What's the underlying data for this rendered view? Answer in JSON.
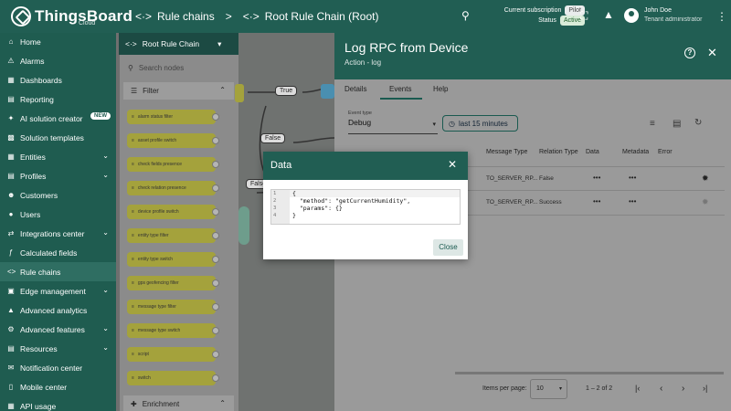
{
  "app": {
    "name": "ThingsBoard",
    "edition": "Cloud"
  },
  "breadcrumbs": {
    "item1": "Rule chains",
    "separator": ">",
    "item2": "Root Rule Chain (Root)"
  },
  "subscription": {
    "label": "Current subscription",
    "plan": "Pilot",
    "status_label": "Status",
    "status": "Active"
  },
  "user": {
    "name": "John Doe",
    "role": "Tenant administrator"
  },
  "sidebar": {
    "items": [
      {
        "label": "Home",
        "icon": "home-icon"
      },
      {
        "label": "Alarms",
        "icon": "bell-icon"
      },
      {
        "label": "Dashboards",
        "icon": "dashboard-icon"
      },
      {
        "label": "Reporting",
        "icon": "report-icon"
      },
      {
        "label": "AI solution creator",
        "icon": "sparkle-icon",
        "badge": "NEW"
      },
      {
        "label": "Solution templates",
        "icon": "template-icon"
      },
      {
        "label": "Entities",
        "icon": "entities-icon"
      },
      {
        "label": "Profiles",
        "icon": "profiles-icon"
      },
      {
        "label": "Customers",
        "icon": "customers-icon"
      },
      {
        "label": "Users",
        "icon": "users-icon"
      },
      {
        "label": "Integrations center",
        "icon": "integrations-icon"
      },
      {
        "label": "Calculated fields",
        "icon": "function-icon"
      },
      {
        "label": "Rule chains",
        "icon": "rule-chain-icon"
      },
      {
        "label": "Edge management",
        "icon": "edge-icon"
      },
      {
        "label": "Advanced analytics",
        "icon": "analytics-icon"
      },
      {
        "label": "Advanced features",
        "icon": "features-icon"
      },
      {
        "label": "Resources",
        "icon": "folder-icon"
      },
      {
        "label": "Notification center",
        "icon": "notification-icon"
      },
      {
        "label": "Mobile center",
        "icon": "mobile-icon"
      },
      {
        "label": "API usage",
        "icon": "api-icon"
      }
    ]
  },
  "library": {
    "header": "Root Rule Chain",
    "search_placeholder": "Search nodes",
    "filter_section": "Filter",
    "enrichment_section": "Enrichment",
    "nodes": [
      "alarm status filter",
      "asset profile switch",
      "check fields presence",
      "check relation presence",
      "device profile switch",
      "entity type filter",
      "entity type switch",
      "gps geofencing filter",
      "message type filter",
      "message type switch",
      "script",
      "switch"
    ]
  },
  "canvas": {
    "labels": [
      "True",
      "False",
      "False"
    ]
  },
  "panel": {
    "title": "Log RPC from Device",
    "subtitle": "Action - log",
    "tabs": [
      "Details",
      "Events",
      "Help"
    ],
    "event_type_label": "Event type",
    "event_type_value": "Debug",
    "time_button": "last 15 minutes",
    "columns": [
      "Message Type",
      "Relation Type",
      "Data",
      "Metadata",
      "Error"
    ],
    "rows": [
      {
        "message_type": "TO_SERVER_RP...",
        "relation_type": "False",
        "data": "•••",
        "metadata": "•••"
      },
      {
        "message_type": "TO_SERVER_RP...",
        "relation_type": "Success",
        "data": "•••",
        "metadata": "•••"
      }
    ],
    "pagination": {
      "label": "Items per page:",
      "per_page": "10",
      "range": "1 – 2 of 2"
    }
  },
  "modal": {
    "title": "Data",
    "code_lines": [
      "{",
      "  \"method\": \"getCurrentHumidity\",",
      "  \"params\": {}",
      "}"
    ],
    "line_numbers": [
      "1",
      "2",
      "3",
      "4"
    ],
    "close_button": "Close"
  }
}
